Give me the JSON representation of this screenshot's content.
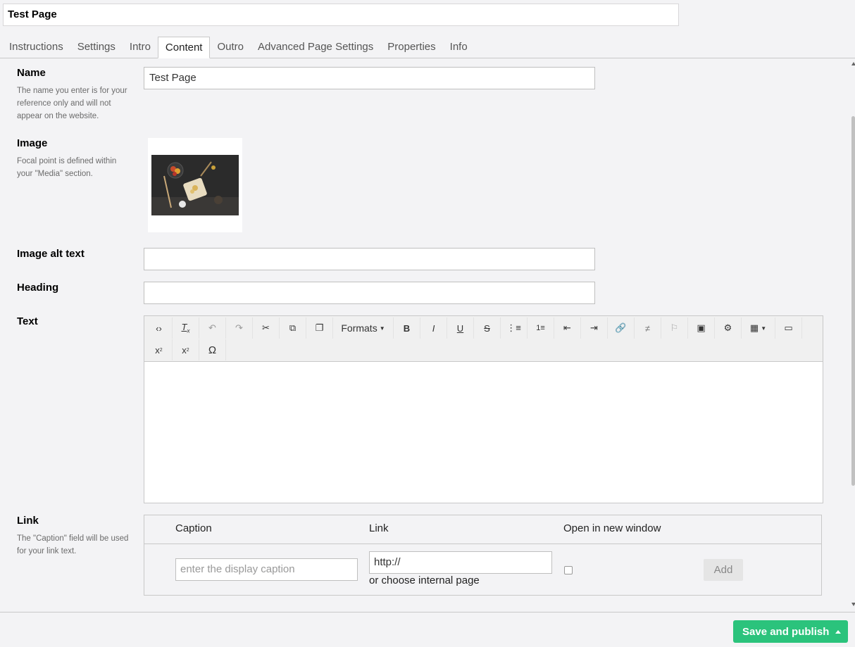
{
  "header": {
    "page_name": "Test Page",
    "tabs": [
      "Instructions",
      "Settings",
      "Intro",
      "Content",
      "Outro",
      "Advanced Page Settings",
      "Properties",
      "Info"
    ],
    "active_tab": "Content"
  },
  "fields": {
    "name": {
      "label": "Name",
      "description": "The name you enter is for your reference only and will not appear on the website.",
      "value": "Test Page"
    },
    "image": {
      "label": "Image",
      "description": "Focal point is defined within your \"Media\" section."
    },
    "image_alt": {
      "label": "Image alt text",
      "value": ""
    },
    "heading": {
      "label": "Heading",
      "value": ""
    },
    "text": {
      "label": "Text",
      "toolbar_formats": "Formats",
      "toolbar_row1_icons": [
        "code-icon",
        "clear-format-icon",
        "undo-icon",
        "redo-icon",
        "cut-icon",
        "copy-icon",
        "paste-icon",
        "formats-dropdown",
        "bold-icon",
        "italic-icon",
        "underline-icon",
        "strikethrough-icon",
        "bullet-list-icon",
        "numbered-list-icon",
        "outdent-icon",
        "indent-icon",
        "link-icon",
        "unlink-icon",
        "anchor-icon",
        "image-icon",
        "macro-icon",
        "table-icon",
        "preview-icon"
      ],
      "toolbar_row2_icons": [
        "subscript-icon",
        "superscript-icon",
        "special-char-icon"
      ]
    },
    "link": {
      "label": "Link",
      "description": "The \"Caption\" field will be used for your link text.",
      "columns": [
        "Caption",
        "Link",
        "Open in new window"
      ],
      "caption_placeholder": "enter the display caption",
      "link_value": "http://",
      "internal_page": "or choose internal page",
      "add_label": "Add"
    }
  },
  "footer": {
    "save_label": "Save and publish"
  },
  "colors": {
    "accent": "#2bc37c",
    "background": "#f3f3f5"
  }
}
